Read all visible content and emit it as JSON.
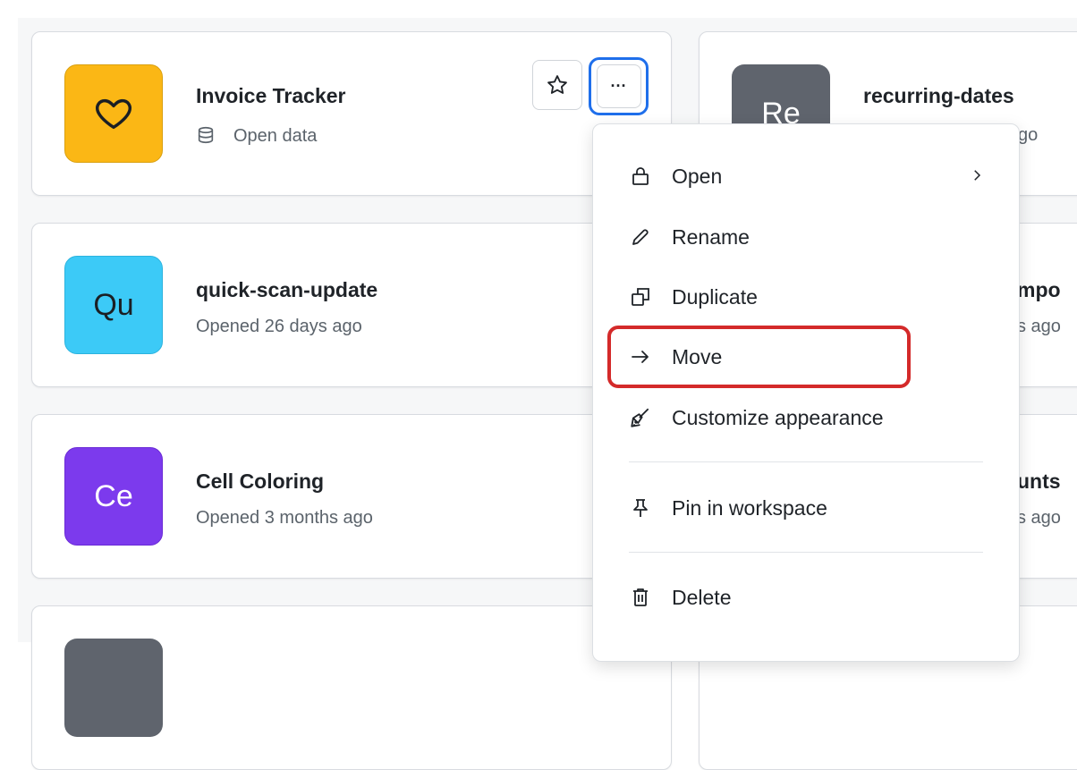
{
  "cards": {
    "invoice": {
      "title": "Invoice Tracker",
      "subtitle": "Open data",
      "icon": "heart-icon",
      "tile_color": "#fbb715"
    },
    "quick": {
      "title": "quick-scan-update",
      "subtitle": "Opened 26 days ago",
      "tile_text": "Qu",
      "tile_color": "#3ccaf7"
    },
    "cell": {
      "title": "Cell Coloring",
      "subtitle": "Opened 3 months ago",
      "tile_text": "Ce",
      "tile_color": "#7c3aed"
    },
    "recurring": {
      "title": "recurring-dates",
      "subtitle_fragment": "go",
      "tile_text": "Re",
      "tile_color": "#5f646d"
    },
    "right_row2": {
      "title_fragment": "mpo",
      "subtitle_fragment": "s ago"
    },
    "right_row3": {
      "title_fragment": "unts",
      "subtitle_fragment": "s ago"
    }
  },
  "toolbar": {
    "star_icon": "star-icon",
    "more_label": "···"
  },
  "context_menu": {
    "items": [
      {
        "label": "Open",
        "icon": "lock-icon",
        "has_submenu": true
      },
      {
        "label": "Rename",
        "icon": "pencil-icon"
      },
      {
        "label": "Duplicate",
        "icon": "duplicate-icon"
      },
      {
        "label": "Move",
        "icon": "arrow-right-icon",
        "highlighted": true
      },
      {
        "label": "Customize appearance",
        "icon": "paintbrush-icon"
      },
      {
        "label": "Pin in workspace",
        "icon": "pin-icon"
      },
      {
        "label": "Delete",
        "icon": "trash-icon"
      }
    ]
  },
  "colors": {
    "highlight": "#d42a2a",
    "focus_ring": "#1f6feb"
  }
}
